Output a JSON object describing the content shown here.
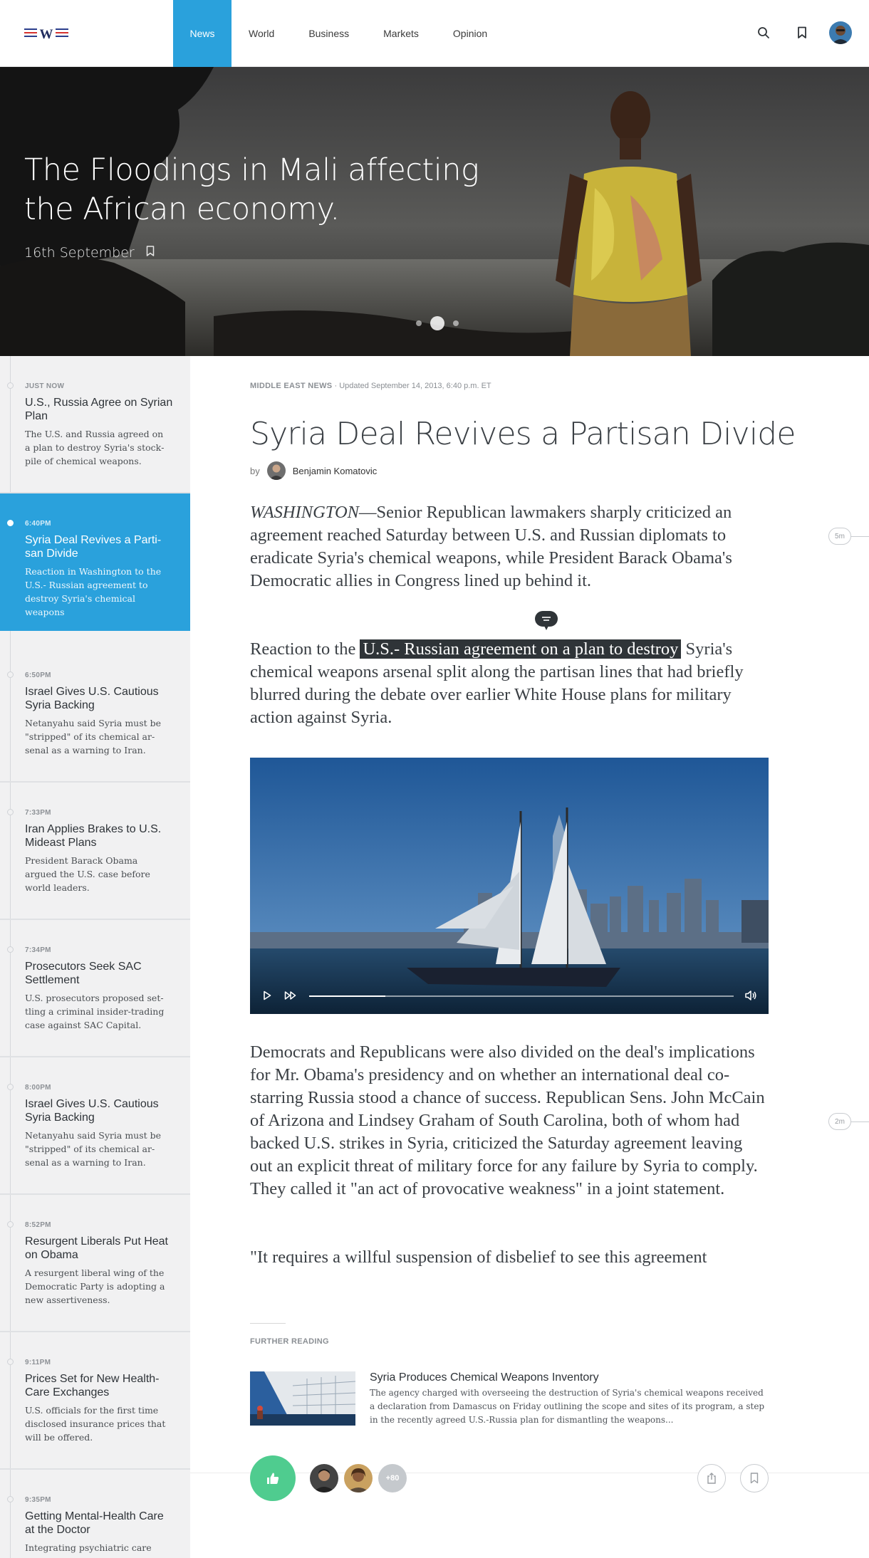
{
  "header": {
    "nav": [
      "News",
      "World",
      "Business",
      "Markets",
      "Opinion"
    ],
    "active_nav": "News"
  },
  "hero": {
    "title": "The Floodings in Mali affecting the African economy.",
    "date": "16th September",
    "slides": 3,
    "active_slide": 2
  },
  "timeline": [
    {
      "time": "JUST NOW",
      "title": "U.S., Russia Agree on Syrian Plan",
      "desc": "The U.S. and Russia agreed on a plan to destroy Syria's stock­pile of chemical weapons.",
      "active": false
    },
    {
      "time": "6:40PM",
      "title": "Syria Deal Revives a Parti­san Divide",
      "desc": "Reaction in Washington to the U.S.- Russian agreement to destroy Syria's chemical weapons",
      "active": true
    },
    {
      "time": "6:50PM",
      "title": "Israel Gives U.S. Cautious Syria Backing",
      "desc": "Netanyahu said Syria must be \"stripped\" of its chemical ar­senal as a warning to Iran.",
      "active": false
    },
    {
      "time": "7:33PM",
      "title": "Iran Applies Brakes to U.S. Mideast Plans",
      "desc": "President Barack Obama argued the U.S. case before world leaders.",
      "active": false
    },
    {
      "time": "7:34PM",
      "title": "Prosecutors Seek SAC Settlement",
      "desc": "U.S. prosecutors proposed set­tling a criminal insider-trad­ing case against SAC Capital.",
      "active": false
    },
    {
      "time": "8:00PM",
      "title": "Israel Gives U.S. Cautious Syria Backing",
      "desc": "Netanyahu said Syria must be \"stripped\" of its chemical ar­senal as a warning to Iran.",
      "active": false
    },
    {
      "time": "8:52PM",
      "title": "Resurgent Liberals Put Heat on Obama",
      "desc": "A resurgent liberal wing of the Democratic Party is adopting a new assertiveness.",
      "active": false
    },
    {
      "time": "9:11PM",
      "title": "Prices Set for New Health-Care Exchanges",
      "desc": "U.S. officials for the first time disclosed insurance prices that will be offered.",
      "active": false
    },
    {
      "time": "9:35PM",
      "title": "Getting Mental-Health Care at the Doctor",
      "desc": "Integrating psychiatric care",
      "active": false
    }
  ],
  "article": {
    "section": "MIDDLE EAST NEWS",
    "updated": "Updated September 14, 2013, 6:40 p.m. ET",
    "title": "Syria Deal Revives a Partisan Divide",
    "by": "by",
    "author": "Benjamin Komatovic",
    "p1_dateline": "WASHINGTON",
    "p1_text": "—Senior Republican lawmakers sharply criticized an agreement reached Saturday between U.S. and Rus­sian diplomats to eradicate Syria's chemical weapons, while Presi­dent Barack Obama's Democratic allies in Congress lined up behind it.",
    "p2_before": "Reaction to the ",
    "p2_highlight": "U.S.- Russian agreement on a plan to destroy",
    "p2_after": " Syria's chemical weapons arsenal split along the partisan lines that had briefly blurred during the debate over earlier White House plans for military action against Syria.",
    "p3": "Democrats and Republicans were also divided on the deal's implications for Mr. Obama's presidency and on whether an international deal co-starring Russia stood a chance of success. Republican Sens. John McCain of Arizona and Lindsey Graham of South Carolina, both of whom had backed U.S. strikes in Syria, criticized the Saturday agreement leaving out an explicit threat of military force for any failure by Syria to comply. They called it \"an act of provocative weakness\" in a joint statement.",
    "p4": "\"It requires a willful suspension of disbelief to see this agreement",
    "video_progress": 0.18
  },
  "further": {
    "label": "FURTHER READING",
    "title": "Syria Produces Chemical Weapons Inventory",
    "desc": "The agency charged with overseeing the destruction of Syria's chemical weapons re­ceived a declaration from Damascus on Friday outlining the scope and sites of its pro­gram, a step in the recently agreed U.S.-Russia plan for dismantling the weapons..."
  },
  "social": {
    "more_count": "+80"
  },
  "read_times": [
    "5m",
    "2m"
  ],
  "colors": {
    "accent": "#2aa1dc",
    "like": "#4fcc8f",
    "highlight": "#2f3438"
  }
}
